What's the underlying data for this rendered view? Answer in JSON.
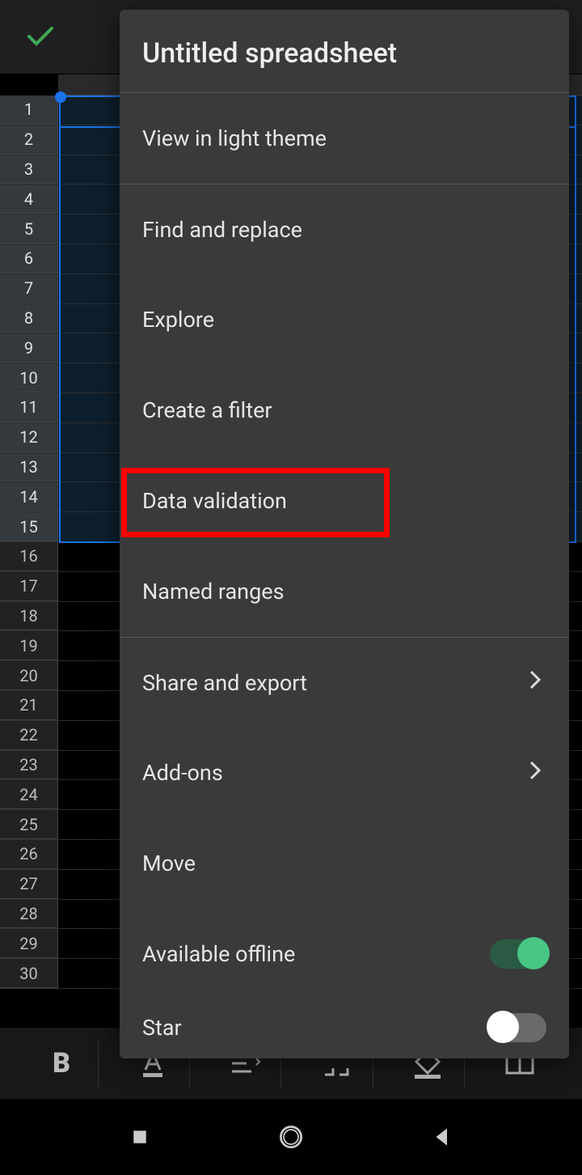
{
  "rows": [
    "1",
    "2",
    "3",
    "4",
    "5",
    "6",
    "7",
    "8",
    "9",
    "10",
    "11",
    "12",
    "13",
    "14",
    "15",
    "16",
    "17",
    "18",
    "19",
    "20",
    "21",
    "22",
    "23",
    "24",
    "25",
    "26",
    "27",
    "28",
    "29",
    "30"
  ],
  "selected_last_row_index": 15,
  "menu": {
    "title": "Untitled spreadsheet",
    "view_theme": "View in light theme",
    "find_replace": "Find and replace",
    "explore": "Explore",
    "create_filter": "Create a filter",
    "data_validation": "Data validation",
    "named_ranges": "Named ranges",
    "share_export": "Share and export",
    "addons": "Add-ons",
    "move": "Move",
    "available_offline": "Available offline",
    "star": "Star"
  },
  "toggles": {
    "available_offline": true,
    "star": false
  },
  "highlight": {
    "target": "data_validation"
  }
}
